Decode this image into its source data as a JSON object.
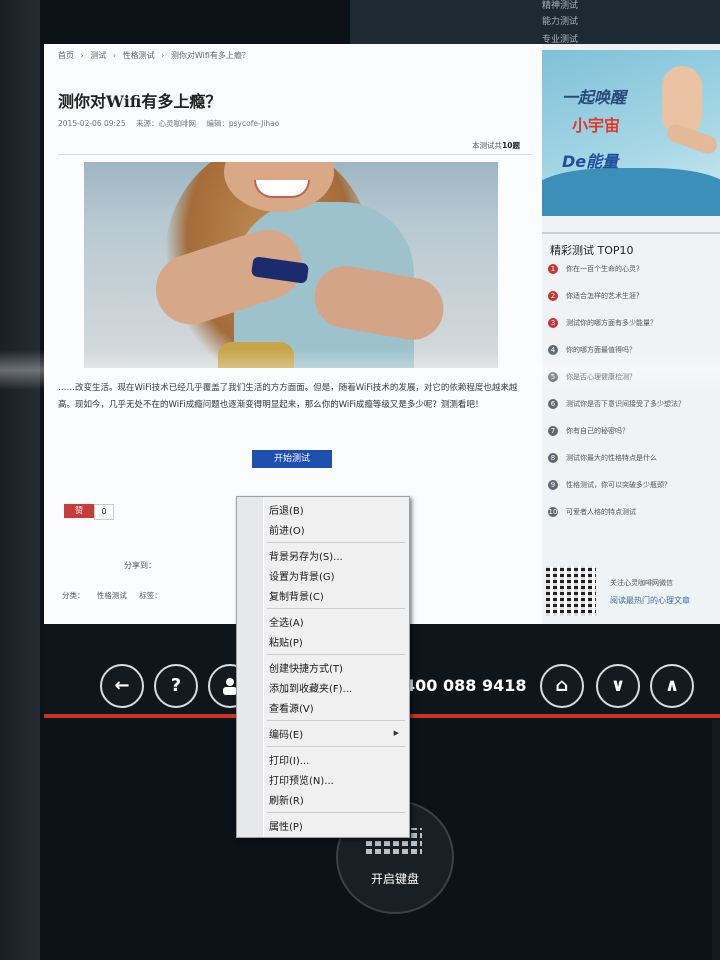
{
  "topnav": [
    "精神测试",
    "能力测试",
    "专业测试"
  ],
  "breadcrumb": [
    "首页",
    "›",
    "测试",
    "›",
    "性格测试",
    "›",
    "测你对Wifi有多上瘾？"
  ],
  "article": {
    "title": "测你对Wifi有多上瘾？",
    "date": "2015-02-06 09:25",
    "source": "来源：心灵咖啡网",
    "editor": "编辑：psycofe-Jihao",
    "count_prefix": "本测试共",
    "count_value": "10题",
    "body": "……改变生活。现在WiFi技术已经几乎覆盖了我们生活的方方面面。但是，随着WiFi技术的发展，对它的依赖程度也越来越高。现如今，几乎无处不在的WiFi成瘾问题也逐渐变得明显起来，那么你的WiFi成瘾等级又是多少呢？测测看吧！",
    "start_button": "开始测试",
    "like_label": "赞",
    "like_count": "0",
    "share_label": "分享到：",
    "category_label": "分类：",
    "category_value": "性格测试",
    "tags_label": "标签："
  },
  "sidebar": {
    "ad": {
      "line1": "一起唤醒",
      "line2": "小宇宙",
      "line3": "De能量"
    },
    "top10_title": "精彩测试 TOP10",
    "top10": [
      "你在一百个生命的心灵？",
      "你适合怎样的艺术生涯？",
      "测试你的哪方面有多少能量？",
      "你的哪方面最值得吗？",
      "你是否心理健康检测？",
      "测试你是否下意识间接受了多少想法？",
      "你有自己的秘密吗？",
      "测试你最大的性格特点是什么",
      "性格测试，你可以突破多少瓶颈？",
      "可爱者人格的特点测试"
    ],
    "qr_label1": "关注心灵咖啡网微信",
    "qr_label2": "阅读最热门的心理文章"
  },
  "kiosk": {
    "back": "←",
    "help": "?",
    "user": "",
    "phone": "400 088 9418",
    "home": "⌂",
    "down": "∨",
    "up": "∧",
    "keyboard_label": "开启键盘"
  },
  "menu": {
    "back": "后退(B)",
    "forward": "前进(O)",
    "save_bg": "背景另存为(S)...",
    "set_bg": "设置为背景(G)",
    "copy_bg": "复制背景(C)",
    "select_all": "全选(A)",
    "paste": "粘贴(P)",
    "shortcut": "创建快捷方式(T)",
    "favorites": "添加到收藏夹(F)...",
    "view_source": "查看源(V)",
    "encoding": "编码(E)",
    "print": "打印(I)...",
    "print_preview": "打印预览(N)...",
    "refresh": "刷新(R)",
    "properties": "属性(P)"
  }
}
